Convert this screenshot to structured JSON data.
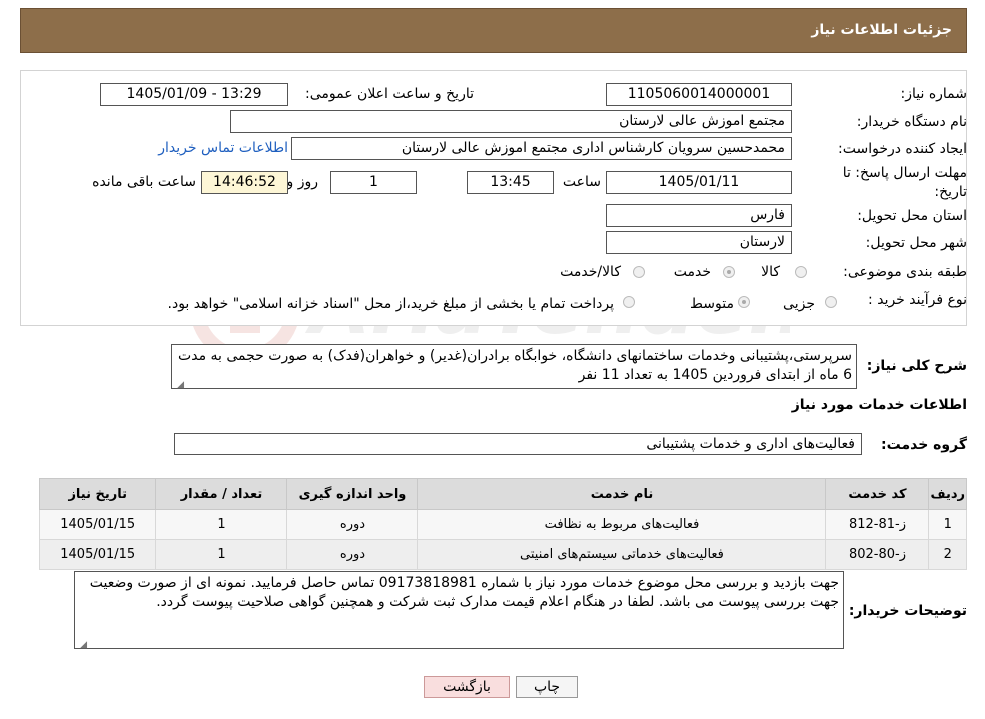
{
  "header": {
    "title": "جزئیات اطلاعات نیاز"
  },
  "form": {
    "need_number_label": "شماره نیاز:",
    "need_number": "1105060014000001",
    "announce_label": "تاریخ و ساعت اعلان عمومی:",
    "announce_value": "1405/01/09 - 13:29",
    "buyer_org_label": "نام دستگاه خریدار:",
    "buyer_org": "مجتمع اموزش عالی لارستان",
    "creator_label": "ایجاد کننده درخواست:",
    "creator": "محمدحسین سرویان کارشناس اداری مجتمع اموزش عالی لارستان",
    "contact_link": "اطلاعات تماس خریدار",
    "deadline_label_1": "مهلت ارسال پاسخ: تا",
    "deadline_label_2": "تاریخ:",
    "deadline_date": "1405/01/11",
    "time_label": "ساعت",
    "deadline_time": "13:45",
    "days_value": "1",
    "days_label": "روز و",
    "remaining_time": "14:46:52",
    "remaining_label": "ساعت باقی مانده",
    "province_label": "استان محل تحویل:",
    "province": "فارس",
    "city_label": "شهر محل تحویل:",
    "city": "لارستان",
    "category_label": "طبقه بندی موضوعی:",
    "category_options": [
      "کالا",
      "خدمت",
      "کالا/خدمت"
    ],
    "purchase_type_label": "نوع فرآیند خرید :",
    "purchase_options": [
      "جزیی",
      "متوسط"
    ],
    "payment_note": "پرداخت تمام یا بخشی از مبلغ خرید،از محل \"اسناد خزانه اسلامی\" خواهد بود."
  },
  "summary": {
    "label": "شرح کلی نیاز:",
    "text": "سرپرستی،پشتیبانی وخدمات ساختمانهای دانشگاه، خوابگاه برادران(غدیر) و خواهران(فدک) به صورت حجمی به مدت 6 ماه از ابتدای فروردین 1405 به تعداد 11 نفر"
  },
  "services": {
    "section_title": "اطلاعات خدمات مورد نیاز",
    "group_label": "گروه خدمت:",
    "group_value": "فعالیت‌های اداری و خدمات پشتیبانی",
    "columns": [
      "ردیف",
      "کد خدمت",
      "نام خدمت",
      "واحد اندازه گیری",
      "تعداد / مقدار",
      "تاریخ نیاز"
    ],
    "rows": [
      [
        "1",
        "ز-81-812",
        "فعالیت‌های مربوط به نظافت",
        "دوره",
        "1",
        "1405/01/15"
      ],
      [
        "2",
        "ز-80-802",
        "فعالیت‌های خدماتی سیستم‌های امنیتی",
        "دوره",
        "1",
        "1405/01/15"
      ]
    ]
  },
  "buyer_notes": {
    "label": "توضیحات خریدار:",
    "text": "جهت بازدید و بررسی محل موضوع خدمات مورد نیاز با شماره 09173818981 تماس حاصل فرمایید. نمونه ای از صورت وضعیت جهت بررسی پیوست می باشد. لطفا در هنگام اعلام قیمت مدارک ثبت شرکت و همچنین گواهی صلاحیت پیوست گردد."
  },
  "buttons": {
    "print": "چاپ",
    "back": "بازگشت"
  },
  "colors": {
    "header_bg": "#8d6e4a",
    "link": "#1f5fbf",
    "back_button_bg": "#f9dede"
  }
}
